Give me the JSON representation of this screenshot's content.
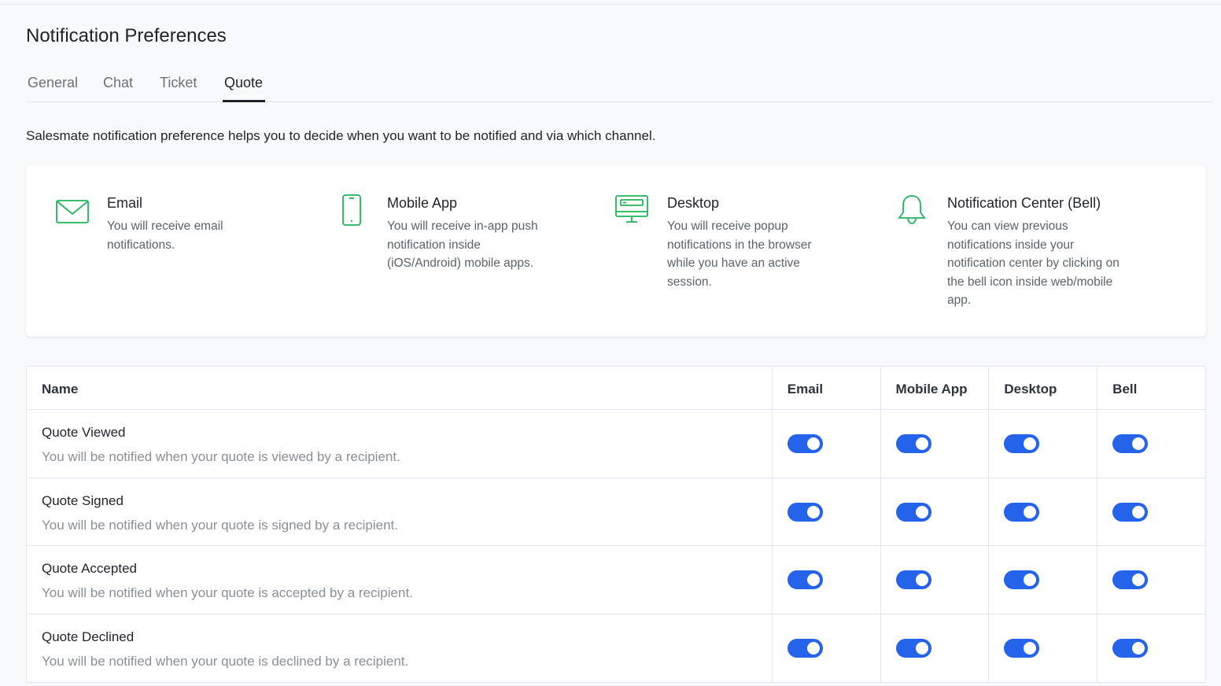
{
  "page": {
    "title": "Notification Preferences",
    "intro": "Salesmate notification preference helps you to decide when you want to be notified and via which channel."
  },
  "tabs": [
    {
      "label": "General",
      "active": false
    },
    {
      "label": "Chat",
      "active": false
    },
    {
      "label": "Ticket",
      "active": false
    },
    {
      "label": "Quote",
      "active": true
    }
  ],
  "channels": [
    {
      "icon": "email-icon",
      "title": "Email",
      "description": "You will receive email notifications."
    },
    {
      "icon": "mobile-icon",
      "title": "Mobile App",
      "description": "You will receive in-app push notification inside (iOS/Android) mobile apps."
    },
    {
      "icon": "desktop-icon",
      "title": "Desktop",
      "description": "You will receive popup notifications in the browser while you have an active session."
    },
    {
      "icon": "bell-icon",
      "title": "Notification Center (Bell)",
      "description": "You can view previous notifications inside your notification center by clicking on the bell icon inside web/mobile app."
    }
  ],
  "table": {
    "headers": [
      "Name",
      "Email",
      "Mobile App",
      "Desktop",
      "Bell"
    ],
    "rows": [
      {
        "title": "Quote Viewed",
        "description": "You will be notified when your quote is viewed by a recipient.",
        "toggles": {
          "email": true,
          "mobile": true,
          "desktop": true,
          "bell": true
        }
      },
      {
        "title": "Quote Signed",
        "description": "You will be notified when your quote is signed by a recipient.",
        "toggles": {
          "email": true,
          "mobile": true,
          "desktop": true,
          "bell": true
        }
      },
      {
        "title": "Quote Accepted",
        "description": "You will be notified when your quote is accepted by a recipient.",
        "toggles": {
          "email": true,
          "mobile": true,
          "desktop": true,
          "bell": true
        }
      },
      {
        "title": "Quote Declined",
        "description": "You will be notified when your quote is declined by a recipient.",
        "toggles": {
          "email": true,
          "mobile": true,
          "desktop": true,
          "bell": true
        }
      }
    ]
  },
  "colors": {
    "accent": "#2563eb",
    "icon": "#22b35e"
  }
}
